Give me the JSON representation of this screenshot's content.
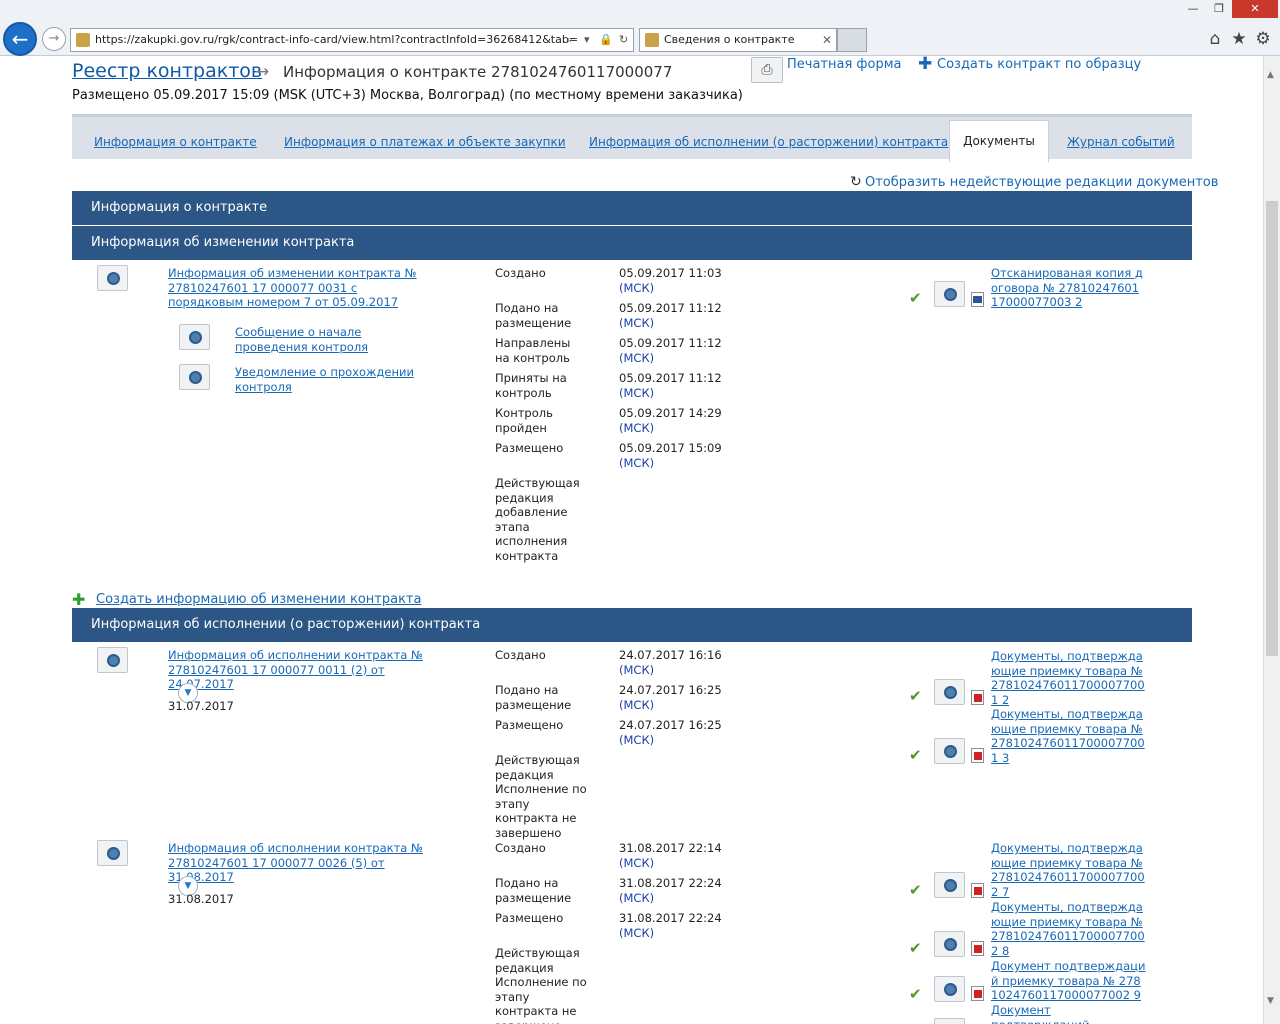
{
  "browser": {
    "url": "https://zakupki.gov.ru/rgk/contract-info-card/view.html?contractInfoId=36268412&tab=",
    "tab_title": "Сведения о контракте",
    "close_tab": "✕",
    "window": {
      "minimize": "—",
      "restore": "❐",
      "close": "✕"
    },
    "icons": {
      "home": "⌂",
      "favorites": "★",
      "settings": "⚙",
      "search": "⌕",
      "lock": "🔒",
      "refresh": "↻",
      "dropdown": "▾"
    }
  },
  "header": {
    "breadcrumb": "Реестр контрактов",
    "arrow": "→",
    "title": "Информация о контракте 2781024760117000077",
    "placed": "Размещено 05.09.2017 15:09 (MSK (UTC+3) Москва, Волгоград) (по местному времени заказчика)",
    "print_icon": "⎙",
    "print_label": "Печатная форма",
    "plus": "✚",
    "create_label": "Создать контракт по образцу"
  },
  "tabs": [
    {
      "label": "Информация о контракте"
    },
    {
      "label": "Информация о платежах и объекте закупки"
    },
    {
      "label": "Информация об исполнении (о расторжении) контракта"
    },
    {
      "label": "Документы"
    },
    {
      "label": "Журнал событий"
    }
  ],
  "toolbar": {
    "reload_icon": "↻",
    "show_label": "Отобразить недействующие редакции документов"
  },
  "sections": {
    "contract_info": "Информация о контракте",
    "changes": "Информация об изменении контракта",
    "execution": "Информация об исполнении (о расторжении) контракта"
  },
  "changes": {
    "title": "Информация об изменении контракта № 27810247601 17 000077 0031 с порядковым номером 7 от 05.09.2017",
    "sub1": "Сообщение о начале проведения контроля",
    "sub2": "Уведомление о прохождении контроля",
    "events": [
      {
        "label": "Создано",
        "date": "05.09.2017 11:03",
        "tz": "(МСК)"
      },
      {
        "label": "Подано на размещение",
        "date": "05.09.2017 11:12",
        "tz": "(МСК)"
      },
      {
        "label": "Направлены на контроль",
        "date": "05.09.2017 11:12",
        "tz": "(МСК)"
      },
      {
        "label": "Приняты на контроль",
        "date": "05.09.2017 11:12",
        "tz": "(МСК)"
      },
      {
        "label": "Контроль пройден",
        "date": "05.09.2017 14:29",
        "tz": "(МСК)"
      },
      {
        "label": "Размещено",
        "date": "05.09.2017 15:09",
        "tz": "(МСК)"
      }
    ],
    "status": "Действующая редакция добавление этапа исполнения контракта",
    "doc": "Отсканированая копия договора № 2781024760117000077003 2"
  },
  "create_change_label": "Создать информацию об изменении контракта",
  "executions": [
    {
      "title": "Информация об исполнении контракта № 27810247601 17 000077 0011 (2) от 24.07.2017",
      "date": "31.07.2017",
      "events": [
        {
          "label": "Создано",
          "date": "24.07.2017 16:16",
          "tz": "(МСК)"
        },
        {
          "label": "Подано на размещение",
          "date": "24.07.2017 16:25",
          "tz": "(МСК)"
        },
        {
          "label": "Размещено",
          "date": "24.07.2017 16:25",
          "tz": "(МСК)"
        }
      ],
      "status": "Действующая редакция Исполнение по этапу контракта не завершено",
      "docs": [
        "Документы, подтверждающие приемку товара № 2781024760117000077001 2",
        "Документы, подтверждающие приемку товара № 2781024760117000077001 3"
      ]
    },
    {
      "title": "Информация об исполнении контракта № 27810247601 17 000077 0026 (5) от 31.08.2017",
      "date": "31.08.2017",
      "events": [
        {
          "label": "Создано",
          "date": "31.08.2017 22:14",
          "tz": "(МСК)"
        },
        {
          "label": "Подано на размещение",
          "date": "31.08.2017 22:24",
          "tz": "(МСК)"
        },
        {
          "label": "Размещено",
          "date": "31.08.2017 22:24",
          "tz": "(МСК)"
        }
      ],
      "status": "Действующая редакция Исполнение по этапу контракта не завершено",
      "docs": [
        "Документы, подтверждающие приемку товара № 2781024760117000077002 7",
        "Документы, подтверждающие приемку товара № 2781024760117000077002 8",
        "Документ подтверждаций приемку товара № 2781024760117000077002 9",
        "Документ подтверждаций"
      ]
    }
  ]
}
